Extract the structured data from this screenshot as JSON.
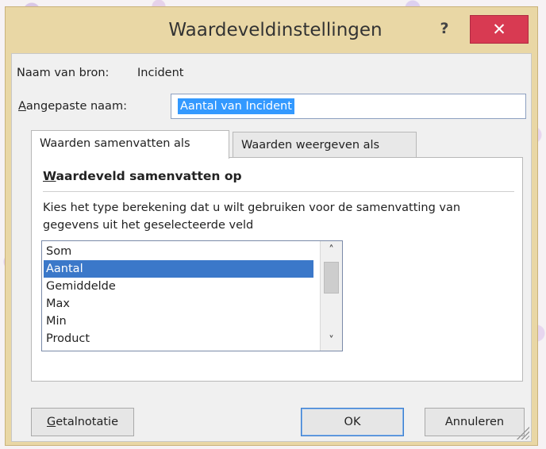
{
  "dialog": {
    "title": "Waardeveldinstellingen",
    "help_label": "?",
    "close_label": "✕",
    "colors": {
      "frame": "#e9d7a5",
      "close": "#d83a52",
      "selection": "#3399ff"
    }
  },
  "source": {
    "label": "Naam van bron:",
    "value": "Incident"
  },
  "custom_name": {
    "label_accel": "A",
    "label_rest": "angepaste naam:",
    "value": "Aantal van Incident"
  },
  "tabs": [
    {
      "label": "Waarden samenvatten als",
      "active": true
    },
    {
      "label": "Waarden weergeven als",
      "active": false
    }
  ],
  "summarize": {
    "heading_accel": "W",
    "heading_rest": "aardeveld samenvatten op",
    "description": "Kies het type berekening dat u wilt gebruiken voor de samenvatting van gegevens uit het geselecteerde veld",
    "items": [
      "Som",
      "Aantal",
      "Gemiddelde",
      "Max",
      "Min",
      "Product"
    ],
    "selected": "Aantal"
  },
  "buttons": {
    "number_format_accel": "G",
    "number_format_rest": "etalnotatie",
    "ok": "OK",
    "cancel": "Annuleren"
  },
  "icons": {
    "scroll_up": "chevron-up-icon",
    "scroll_down": "chevron-down-icon",
    "resize": "resize-grip-icon"
  }
}
